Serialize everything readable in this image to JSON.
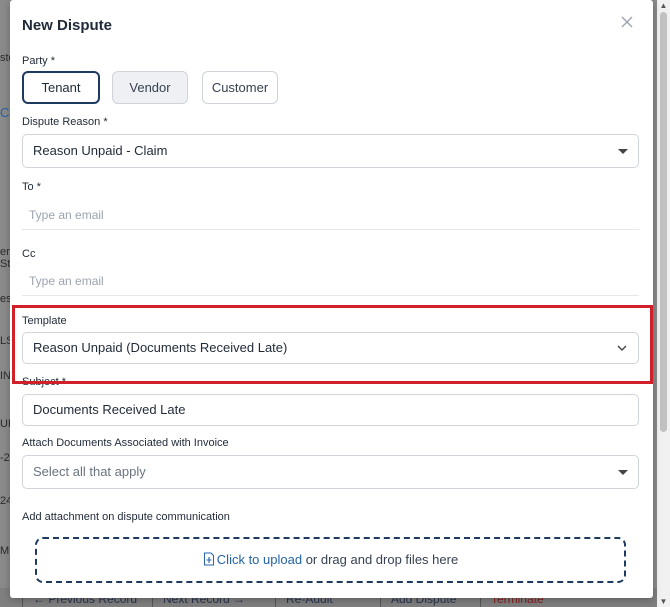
{
  "background": {
    "fragments": [
      "sto",
      "C",
      "er",
      "Sta",
      "es",
      "LS",
      "IN",
      "UF",
      "-2",
      "24",
      "M"
    ],
    "bottom_bar": {
      "previous_record": "← Previous Record",
      "next_record": "Next Record →",
      "re_audit": "Re-Audit",
      "add_dispute": "Add Dispute",
      "terminate": "Terminate"
    }
  },
  "modal": {
    "title": "New Dispute",
    "party": {
      "label": "Party *",
      "options": [
        "Tenant",
        "Vendor",
        "Customer"
      ],
      "selected": "Tenant"
    },
    "dispute_reason": {
      "label": "Dispute Reason *",
      "value": "Reason Unpaid - Claim"
    },
    "to": {
      "label": "To *",
      "placeholder": "Type an email"
    },
    "cc": {
      "label": "Cc",
      "placeholder": "Type an email"
    },
    "template": {
      "label": "Template",
      "value": "Reason Unpaid (Documents Received Late)"
    },
    "subject": {
      "label": "Subject *",
      "value": "Documents Received Late"
    },
    "attach_documents": {
      "label": "Attach Documents Associated with Invoice",
      "placeholder": "Select all that apply"
    },
    "attachment": {
      "label": "Add attachment on dispute communication",
      "link_text": "Click to upload",
      "rest_text": " or drag and drop files here"
    }
  },
  "colors": {
    "highlight": "#d0202a",
    "active_border": "#1e3a5f",
    "link": "#2563a8"
  }
}
